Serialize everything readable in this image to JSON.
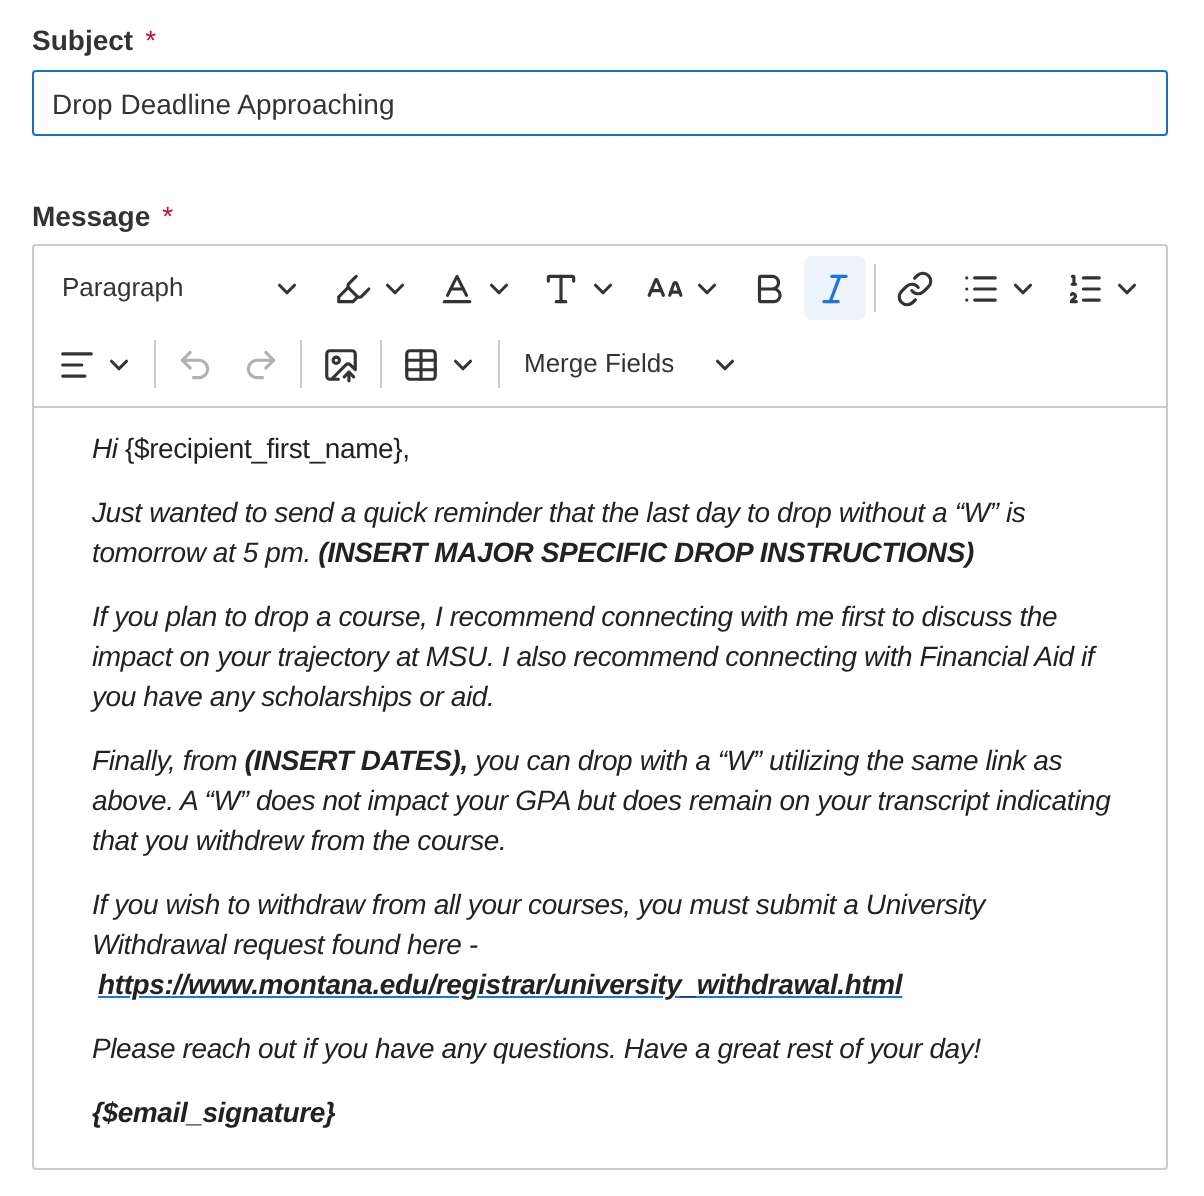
{
  "subject": {
    "label": "Subject",
    "required_mark": "*",
    "value": "Drop Deadline Approaching"
  },
  "message": {
    "label": "Message",
    "required_mark": "*",
    "toolbar_rows": [
      [
        {
          "kind": "select",
          "label": "Paragraph"
        },
        {
          "kind": "tool",
          "caret": true,
          "selected": false,
          "disabled": false
        },
        {
          "kind": "tool",
          "caret": true,
          "selected": false,
          "disabled": false
        },
        {
          "kind": "tool",
          "caret": true,
          "selected": false,
          "disabled": false
        },
        {
          "kind": "tool",
          "caret": true,
          "selected": false,
          "disabled": false
        },
        {
          "kind": "tool",
          "caret": false,
          "selected": false,
          "disabled": false
        },
        {
          "kind": "tool",
          "caret": false,
          "selected": true,
          "disabled": false
        },
        {
          "kind": "separator"
        },
        {
          "kind": "tool",
          "caret": false,
          "selected": false,
          "disabled": false
        },
        {
          "kind": "tool",
          "caret": true,
          "selected": false,
          "disabled": false
        },
        {
          "kind": "tool",
          "caret": true,
          "selected": false,
          "disabled": false
        }
      ],
      [
        {
          "kind": "tool",
          "caret": true,
          "selected": false,
          "disabled": false
        },
        {
          "kind": "separator"
        },
        {
          "kind": "tool",
          "caret": false,
          "selected": false,
          "disabled": true
        },
        {
          "kind": "tool",
          "caret": false,
          "selected": false,
          "disabled": true
        },
        {
          "kind": "separator"
        },
        {
          "kind": "tool",
          "caret": false,
          "selected": false,
          "disabled": false
        },
        {
          "kind": "separator"
        },
        {
          "kind": "tool",
          "caret": true,
          "selected": false,
          "disabled": false
        },
        {
          "kind": "separator"
        },
        {
          "kind": "select",
          "label": "Merge Fields"
        }
      ]
    ],
    "paragraphs": [
      {
        "kind": "plain",
        "text": "*Hi* {$recipient_first_name},"
      },
      {
        "kind": "italic",
        "text": "Just wanted to send a quick reminder that the last day to drop without a “W” is tomorrow at 5 pm. **(INSERT MAJOR SPECIFIC DROP INSTRUCTIONS)**"
      },
      {
        "kind": "italic",
        "text": "If you plan to drop a course, I recommend connecting with me first to discuss the impact on your trajectory at MSU. I also recommend connecting with Financial Aid if you have any scholarships or aid."
      },
      {
        "kind": "italic",
        "text": "Finally, from **(INSERT DATES),** you can drop with a “W” utilizing the same link as above. A “W” does not impact your GPA but does remain on your transcript indicating that you withdrew from the course."
      },
      {
        "kind": "italic",
        "text": "If you wish to withdraw from all your courses, you must submit a University Withdrawal request found here -",
        "link": "https://www.montana.edu/registrar/university_withdrawal.html"
      },
      {
        "kind": "italic",
        "text": "Please reach out if you have any questions. Have a great rest of your day!"
      },
      {
        "kind": "bold_italic",
        "text": "{$email_signature}"
      }
    ]
  }
}
